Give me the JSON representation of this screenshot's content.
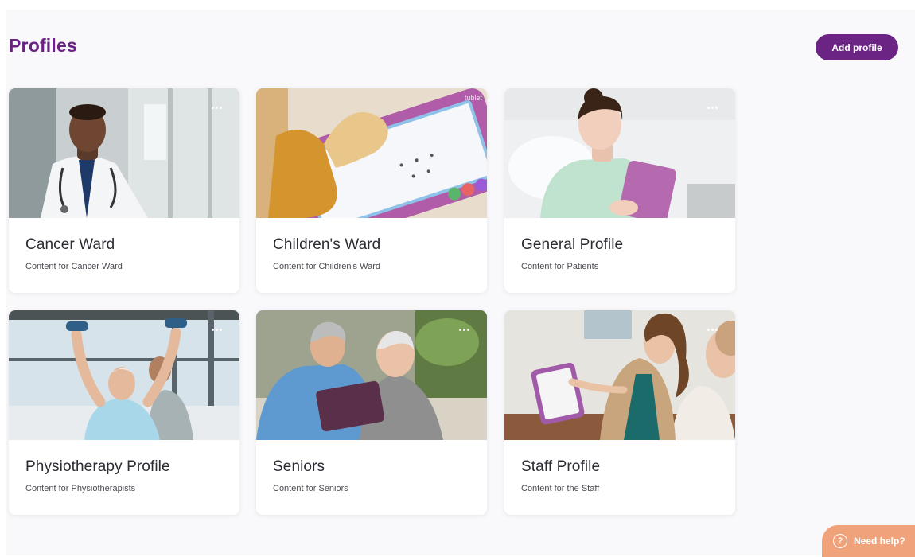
{
  "header": {
    "title": "Profiles",
    "add_button_label": "Add profile"
  },
  "profiles": [
    {
      "title": "Cancer Ward",
      "subtitle": "Content for Cancer Ward",
      "image": "doctor-with-stethoscope"
    },
    {
      "title": "Children's Ward",
      "subtitle": "Content for Children's Ward",
      "image": "child-using-purple-tablet"
    },
    {
      "title": "General Profile",
      "subtitle": "Content for Patients",
      "image": "patient-in-bed-with-tablet"
    },
    {
      "title": "Physiotherapy Profile",
      "subtitle": "Content for Physiotherapists",
      "image": "senior-lifting-dumbbells"
    },
    {
      "title": "Seniors",
      "subtitle": "Content for Seniors",
      "image": "caregiver-and-senior-with-tablet"
    },
    {
      "title": "Staff Profile",
      "subtitle": "Content for the Staff",
      "image": "nurse-showing-tablet"
    }
  ],
  "help": {
    "label": "Need help?",
    "icon": "?"
  },
  "colors": {
    "brand": "#6b2484",
    "help": "#f0a27a"
  }
}
